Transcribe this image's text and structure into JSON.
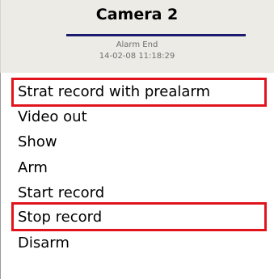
{
  "panel": {
    "title": "Camera 2",
    "state": "Alarm End",
    "timestamp": "14-02-08 11:18:29",
    "accent_color": "#1a1a70",
    "highlight_color": "#e1141e"
  },
  "menu": {
    "items": [
      {
        "label": "Strat record with prealarm",
        "highlighted": true
      },
      {
        "label": "Video out",
        "highlighted": false
      },
      {
        "label": "Show",
        "highlighted": false
      },
      {
        "label": "Arm",
        "highlighted": false
      },
      {
        "label": "Start record",
        "highlighted": false
      },
      {
        "label": "Stop record",
        "highlighted": true
      },
      {
        "label": "Disarm",
        "highlighted": false
      }
    ]
  }
}
